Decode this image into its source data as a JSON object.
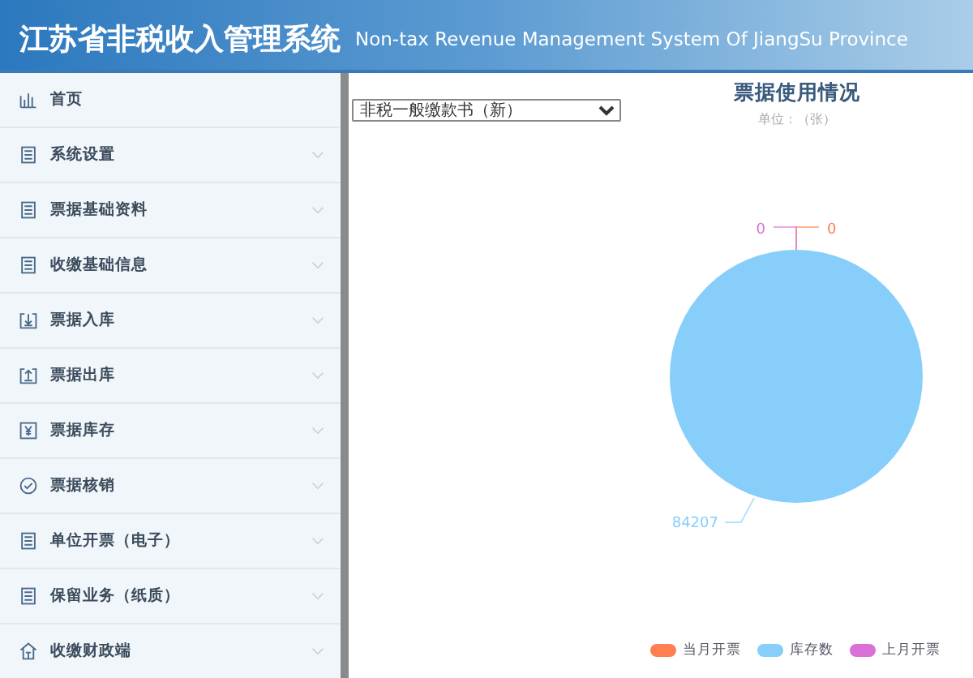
{
  "header": {
    "title": "江苏省非税收入管理系统",
    "subtitle": "Non-tax Revenue Management System Of JiangSu Province"
  },
  "sidebar": {
    "items": [
      {
        "label": "首页",
        "kind": "chart",
        "expandable": false
      },
      {
        "label": "系统设置",
        "kind": "list",
        "expandable": true
      },
      {
        "label": "票据基础资料",
        "kind": "list",
        "expandable": true
      },
      {
        "label": "收缴基础信息",
        "kind": "list",
        "expandable": true
      },
      {
        "label": "票据入库",
        "kind": "import",
        "expandable": true
      },
      {
        "label": "票据出库",
        "kind": "export",
        "expandable": true
      },
      {
        "label": "票据库存",
        "kind": "stock",
        "expandable": true
      },
      {
        "label": "票据核销",
        "kind": "check",
        "expandable": true
      },
      {
        "label": "单位开票（电子）",
        "kind": "list",
        "expandable": true
      },
      {
        "label": "保留业务（纸质）",
        "kind": "list",
        "expandable": true
      },
      {
        "label": "收缴财政端",
        "kind": "home",
        "expandable": true
      }
    ]
  },
  "main": {
    "bill_type_select": {
      "value": "非税一般缴款书（新）"
    },
    "chart_data": {
      "type": "pie",
      "title": "票据使用情况",
      "subtitle": "单位：（张）",
      "categories": [
        "当月开票",
        "库存数",
        "上月开票"
      ],
      "colors": [
        "#ff7f50",
        "#87cefa",
        "#da70d6"
      ],
      "values": [
        0,
        84207,
        0
      ],
      "value_labels": [
        "0",
        "84207",
        "0"
      ]
    }
  }
}
